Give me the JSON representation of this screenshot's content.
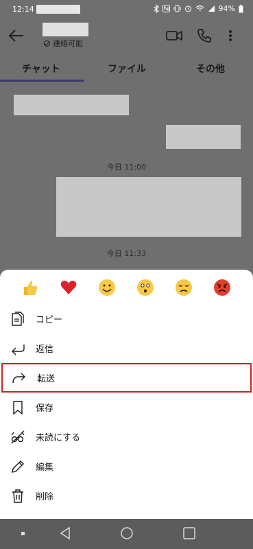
{
  "status_bar": {
    "time": "12:14",
    "battery": "94%"
  },
  "header": {
    "presence": "連絡可能"
  },
  "tabs": [
    {
      "label": "チャット"
    },
    {
      "label": "ファイル"
    },
    {
      "label": "その他"
    }
  ],
  "chat": {
    "timestamps": [
      "今日 11:00",
      "今日 11:33"
    ]
  },
  "reactions": [
    {
      "icon": "thumbs-up-icon"
    },
    {
      "icon": "heart-icon"
    },
    {
      "icon": "smile-icon"
    },
    {
      "icon": "surprised-icon"
    },
    {
      "icon": "sad-icon"
    },
    {
      "icon": "angry-icon"
    }
  ],
  "menu": {
    "items": [
      {
        "label": "コピー",
        "icon": "copy-icon"
      },
      {
        "label": "返信",
        "icon": "reply-icon"
      },
      {
        "label": "転送",
        "icon": "forward-icon"
      },
      {
        "label": "保存",
        "icon": "bookmark-icon"
      },
      {
        "label": "未読にする",
        "icon": "mark-unread-icon"
      },
      {
        "label": "編集",
        "icon": "pencil-icon"
      },
      {
        "label": "削除",
        "icon": "trash-icon"
      }
    ]
  },
  "colors": {
    "highlight_border": "#d0202a",
    "overlay": "#6f6f6f",
    "sheet": "#ffffff"
  }
}
